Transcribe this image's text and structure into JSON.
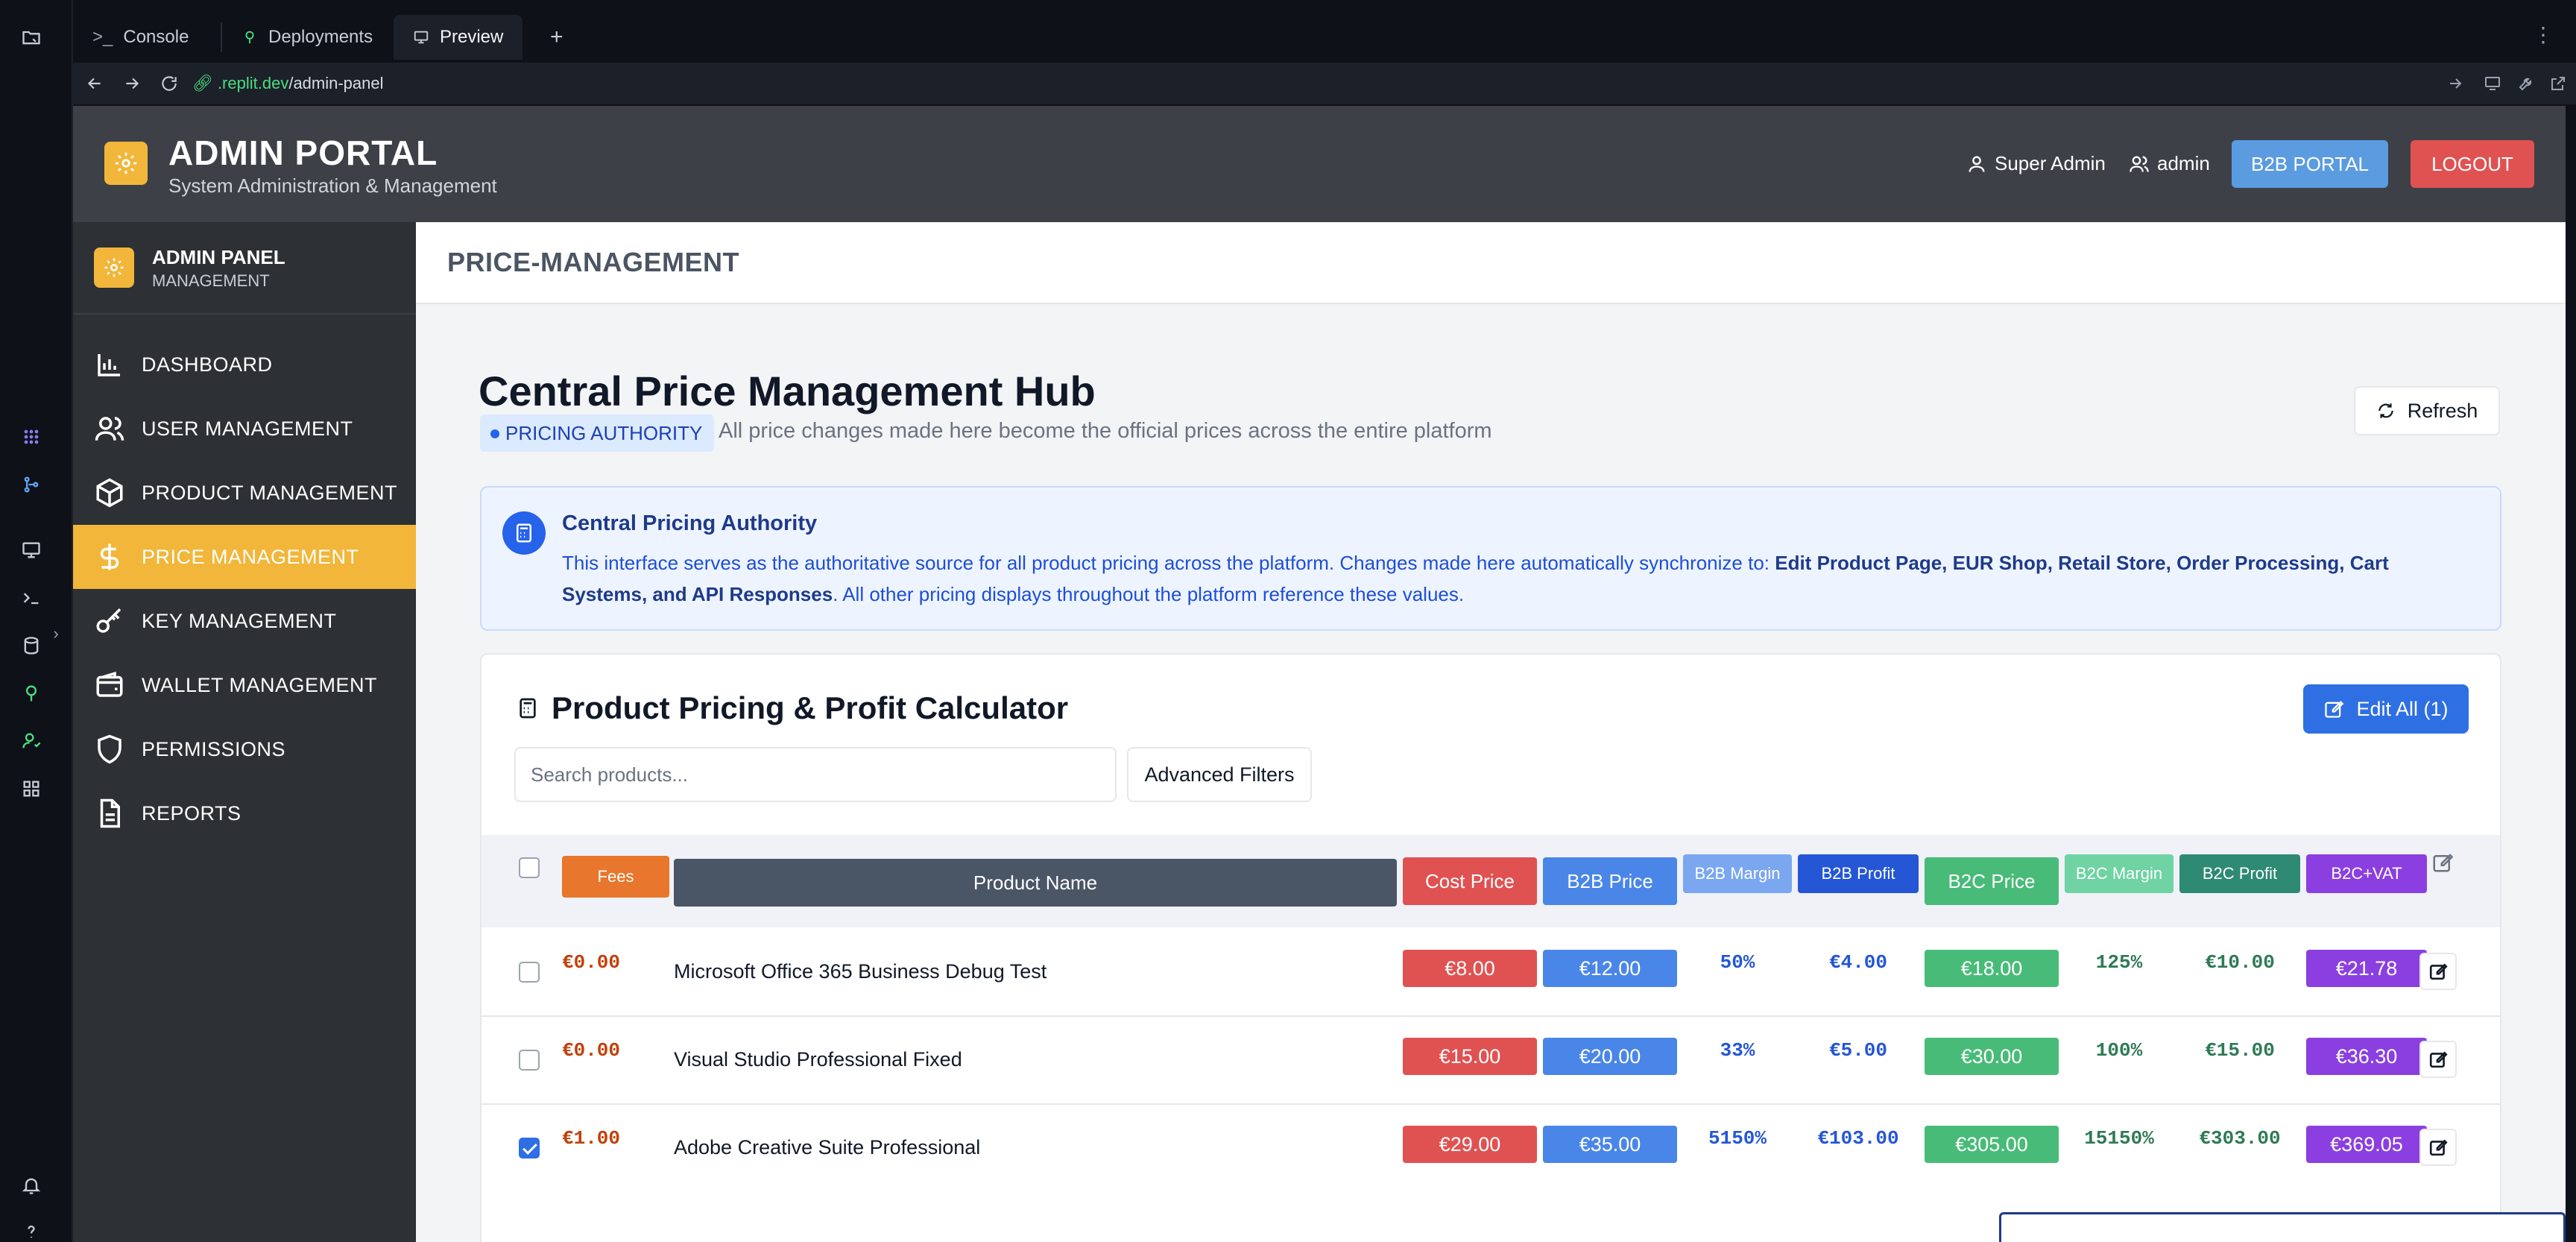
{
  "ide": {
    "tabs": [
      {
        "label": "Console",
        "icon": "terminal-icon"
      },
      {
        "label": "Deployments",
        "icon": "deploy-icon"
      },
      {
        "label": "Preview",
        "icon": "monitor-icon"
      }
    ],
    "new_tab_label": "+",
    "url_host": ".replit.dev",
    "url_path": "/admin-panel"
  },
  "header": {
    "title": "ADMIN PORTAL",
    "subtitle": "System Administration & Management",
    "role_label": "Super Admin",
    "user_label": "admin",
    "b2b_button": "B2B PORTAL",
    "logout_button": "LOGOUT"
  },
  "sidebar": {
    "title": "ADMIN PANEL",
    "subtitle": "MANAGEMENT",
    "items": [
      {
        "label": "DASHBOARD",
        "icon": "chart-icon"
      },
      {
        "label": "USER MANAGEMENT",
        "icon": "users-icon"
      },
      {
        "label": "PRODUCT MANAGEMENT",
        "icon": "box-icon"
      },
      {
        "label": "PRICE MANAGEMENT",
        "icon": "dollar-icon",
        "active": true
      },
      {
        "label": "KEY MANAGEMENT",
        "icon": "key-icon"
      },
      {
        "label": "WALLET MANAGEMENT",
        "icon": "wallet-icon"
      },
      {
        "label": "PERMISSIONS",
        "icon": "shield-icon"
      },
      {
        "label": "REPORTS",
        "icon": "file-icon"
      }
    ]
  },
  "page": {
    "breadcrumb": "PRICE-MANAGEMENT",
    "title": "Central Price Management Hub",
    "badge": "PRICING AUTHORITY",
    "description": "All price changes made here become the official prices across the entire platform",
    "refresh_label": "Refresh"
  },
  "notice": {
    "title": "Central Pricing Authority",
    "body_prefix": "This interface serves as the authoritative source for all product pricing across the platform. Changes made here automatically synchronize to: ",
    "targets": "Edit Product Page, EUR Shop, Retail Store, Order Processing, Cart Systems, and API Responses",
    "body_suffix": ". All other pricing displays throughout the platform reference these values."
  },
  "calculator": {
    "title": "Product Pricing & Profit Calculator",
    "edit_all_label": "Edit All (1)",
    "search_placeholder": "Search products...",
    "advanced_filters_label": "Advanced Filters",
    "columns": {
      "fees": "Fees",
      "product_name": "Product Name",
      "cost_price": "Cost Price",
      "b2b_price": "B2B Price",
      "b2b_margin": "B2B Margin",
      "b2b_profit": "B2B Profit",
      "b2c_price": "B2C Price",
      "b2c_margin": "B2C Margin",
      "b2c_profit": "B2C Profit",
      "b2c_vat": "B2C+VAT"
    },
    "rows": [
      {
        "checked": false,
        "fees": "€0.00",
        "name": "Microsoft Office 365 Business Debug Test",
        "cost": "€8.00",
        "b2b_price": "€12.00",
        "b2b_margin": "50%",
        "b2b_profit": "€4.00",
        "b2c_price": "€18.00",
        "b2c_margin": "125%",
        "b2c_profit": "€10.00",
        "b2c_vat": "€21.78"
      },
      {
        "checked": false,
        "fees": "€0.00",
        "name": "Visual Studio Professional Fixed",
        "cost": "€15.00",
        "b2b_price": "€20.00",
        "b2b_margin": "33%",
        "b2b_profit": "€5.00",
        "b2c_price": "€30.00",
        "b2c_margin": "100%",
        "b2c_profit": "€15.00",
        "b2c_vat": "€36.30"
      },
      {
        "checked": true,
        "fees": "€1.00",
        "name": "Adobe Creative Suite Professional",
        "cost": "€29.00",
        "b2b_price": "€35.00",
        "b2b_margin": "5150%",
        "b2b_profit": "€103.00",
        "b2c_price": "€305.00",
        "b2c_margin": "15150%",
        "b2c_profit": "€303.00",
        "b2c_vat": "€369.05"
      }
    ]
  },
  "colors": {
    "accent": "#f2b63a",
    "header_bg": "#3d4147",
    "sidebar_bg": "#2d3035",
    "fees": "#e8762c",
    "product_name": "#4a5566",
    "cost": "#e05252",
    "b2b_price": "#4a86e8",
    "b2b_margin": "#7aa7f0",
    "b2b_profit": "#2456d6",
    "b2c_price": "#48bb78",
    "b2c_margin": "#6fd3a3",
    "b2c_profit": "#2f8a73",
    "b2c_vat": "#8b3fe0",
    "b2b_button": "#5b9be0",
    "logout_button": "#e05252"
  }
}
